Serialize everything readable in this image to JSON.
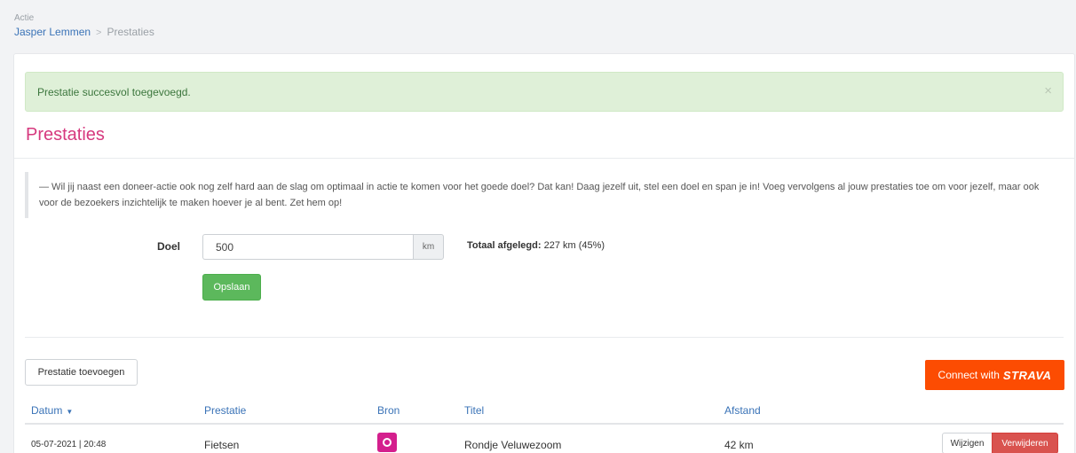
{
  "header": {
    "section_label": "Actie",
    "breadcrumb": {
      "parent": "Jasper Lemmen",
      "separator": ">",
      "current": "Prestaties"
    }
  },
  "alert": {
    "message": "Prestatie succesvol toegevoegd.",
    "close": "×",
    "color": "#dff0d8"
  },
  "page": {
    "title": "Prestaties",
    "title_color": "#d6397e",
    "intro": "— Wil jij naast een doneer-actie ook nog zelf hard aan de slag om optimaal in actie te komen voor het goede doel? Dat kan! Daag jezelf uit, stel een doel en span je in! Voeg vervolgens al jouw prestaties toe om voor jezelf, maar ook voor de bezoekers inzichtelijk te maken hoever je al bent. Zet hem op!"
  },
  "goal_form": {
    "label": "Doel",
    "value": "500",
    "unit": "km",
    "total_label": "Totaal afgelegd:",
    "total_value": "227 km (45%)",
    "save_label": "Opslaan"
  },
  "actions": {
    "add_label": "Prestatie toevoegen",
    "strava_prefix": "Connect with",
    "strava_brand": "STRAVA",
    "strava_color": "#fc4c02"
  },
  "table": {
    "columns": [
      "Datum",
      "Prestatie",
      "Bron",
      "Titel",
      "Afstand"
    ],
    "sort_indicator": "▼",
    "rows": [
      {
        "datum": "05-07-2021 | 20:48",
        "prestatie": "Fietsen",
        "bron_icon": "strava-app-icon",
        "titel": "Rondje Veluwezoom",
        "afstand": "42 km",
        "edit_label": "Wijzigen",
        "delete_label": "Verwijderen"
      }
    ]
  }
}
